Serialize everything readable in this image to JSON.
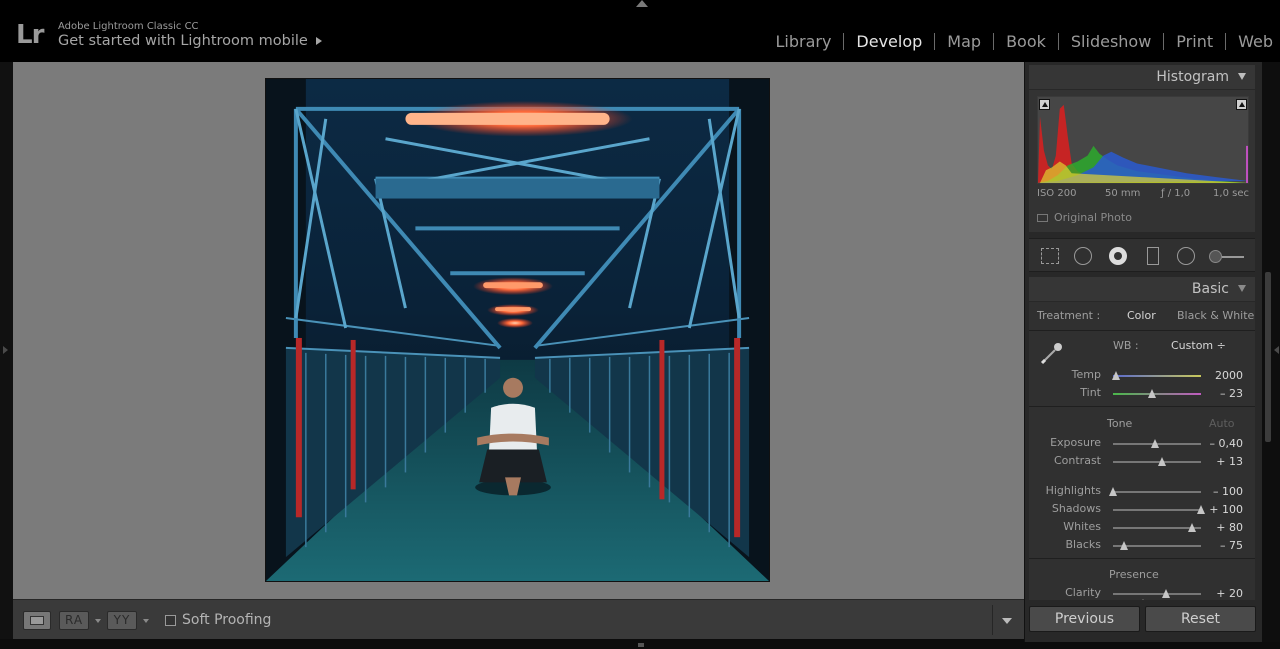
{
  "app": {
    "logo": "Lr",
    "name": "Adobe Lightroom Classic CC",
    "mobile_link": "Get started with Lightroom mobile"
  },
  "modules": [
    {
      "label": "Library",
      "active": false
    },
    {
      "label": "Develop",
      "active": true
    },
    {
      "label": "Map",
      "active": false
    },
    {
      "label": "Book",
      "active": false
    },
    {
      "label": "Slideshow",
      "active": false
    },
    {
      "label": "Print",
      "active": false
    },
    {
      "label": "Web",
      "active": false
    }
  ],
  "histogram": {
    "title": "Histogram",
    "iso": "ISO 200",
    "focal": "50 mm",
    "aperture": "ƒ / 1,0",
    "shutter": "1,0 sec",
    "original_photo": "Original Photo"
  },
  "basic": {
    "title": "Basic",
    "treatment_label": "Treatment :",
    "treatment_color": "Color",
    "treatment_bw": "Black & White",
    "wb_label": "WB :",
    "wb_value": "Custom ÷",
    "temp": {
      "label": "Temp",
      "value": "2000",
      "position": 0.03
    },
    "tint": {
      "label": "Tint",
      "value": "– 23",
      "position": 0.44
    },
    "tone_label": "Tone",
    "auto_label": "Auto",
    "exposure": {
      "label": "Exposure",
      "value": "– 0,40",
      "position": 0.48
    },
    "contrast": {
      "label": "Contrast",
      "value": "+ 13",
      "position": 0.56
    },
    "highlights": {
      "label": "Highlights",
      "value": "– 100",
      "position": 0.0
    },
    "shadows": {
      "label": "Shadows",
      "value": "+ 100",
      "position": 1.0
    },
    "whites": {
      "label": "Whites",
      "value": "+ 80",
      "position": 0.9
    },
    "blacks": {
      "label": "Blacks",
      "value": "– 75",
      "position": 0.12
    },
    "presence_label": "Presence",
    "clarity": {
      "label": "Clarity",
      "value": "+ 20",
      "position": 0.6
    }
  },
  "buttons": {
    "previous": "Previous",
    "reset": "Reset"
  },
  "toolbar": {
    "ra_label": "RA",
    "yy_label": "YY",
    "soft_proofing": "Soft Proofing"
  },
  "colors": {
    "accent_active": "#e4e4e4",
    "panel_bg": "#282828",
    "canvas_bg": "#7b7b7b"
  }
}
